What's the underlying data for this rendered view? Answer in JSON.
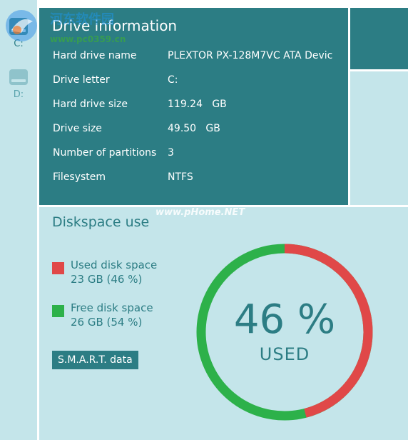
{
  "sidebar": {
    "drives": [
      {
        "label": "C:",
        "active": true
      },
      {
        "label": "D:",
        "active": false
      }
    ]
  },
  "drive_info": {
    "title": "Drive information",
    "rows": [
      {
        "label": "Hard drive name",
        "value": "PLEXTOR PX-128M7VC ATA Devic"
      },
      {
        "label": "Drive letter",
        "value": "C:"
      },
      {
        "label": "Hard drive size",
        "value": "119.24   GB"
      },
      {
        "label": "Drive size",
        "value": "49.50   GB"
      },
      {
        "label": "Number of partitions",
        "value": "3"
      },
      {
        "label": "Filesystem",
        "value": "NTFS"
      }
    ]
  },
  "diskspace": {
    "title": "Diskspace use",
    "used_label": "Used disk space",
    "used_value": "23 GB (46 %)",
    "free_label": "Free disk space",
    "free_value": "26 GB (54 %)",
    "smart_button": "S.M.A.R.T. data",
    "percent_text": "46 %",
    "used_caption": "USED",
    "used_fraction": 0.46,
    "used_color": "#e04848",
    "free_color": "#2db14a"
  },
  "watermarks": {
    "site_name": "河东软件园",
    "site_url": "www.pc0359.cn",
    "site_url_2": "www.pHome.NET"
  }
}
